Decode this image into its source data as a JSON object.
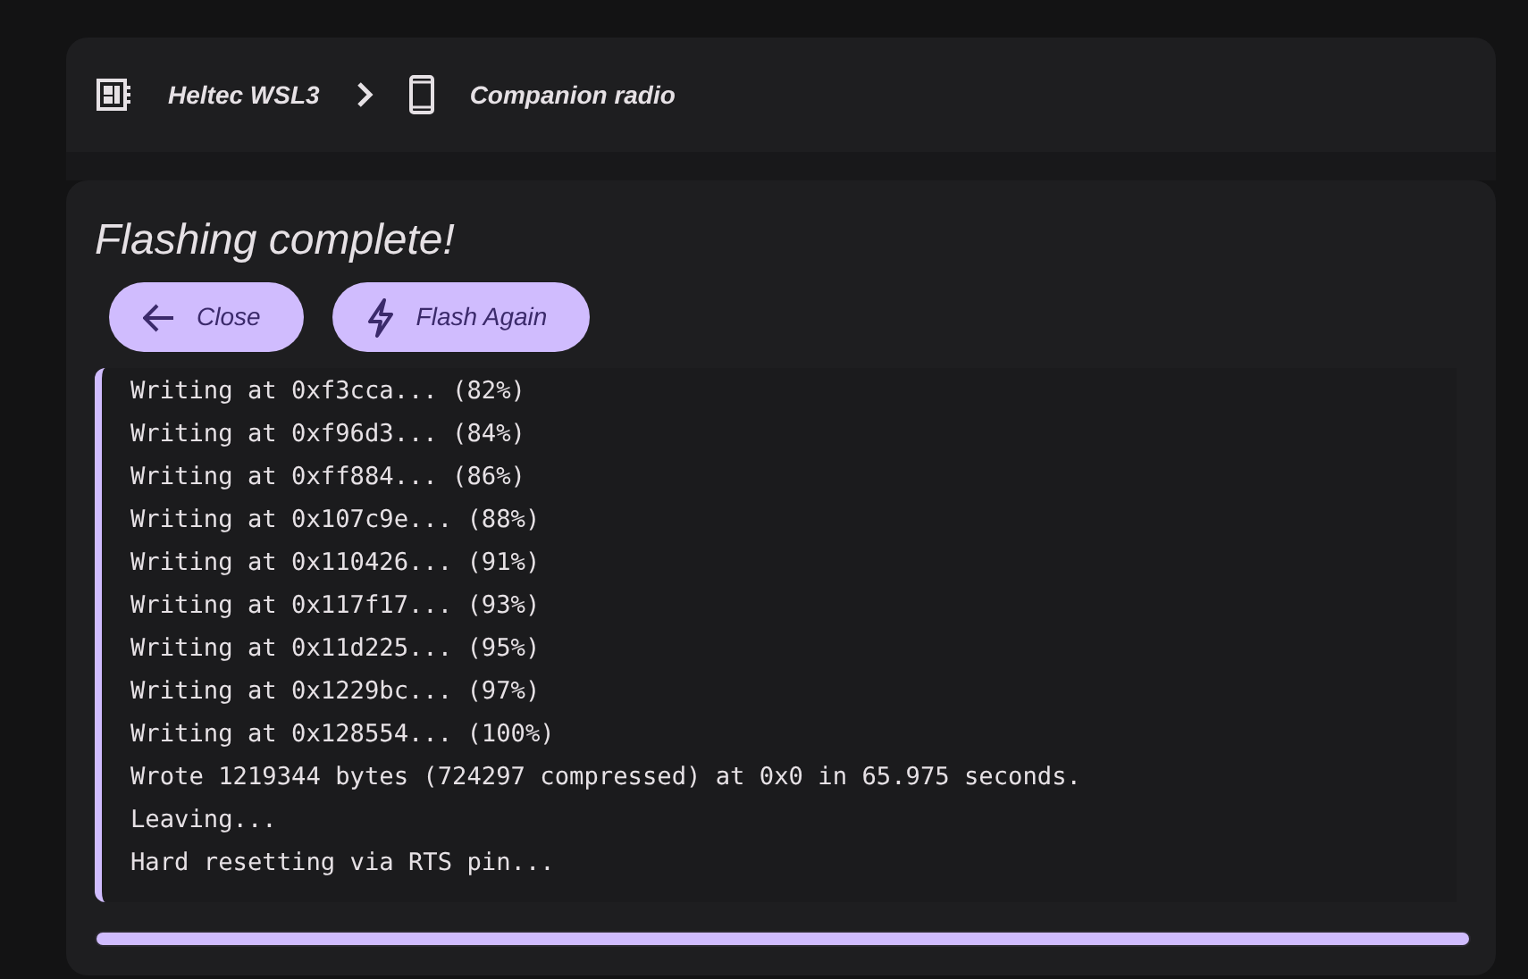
{
  "breadcrumb": [
    {
      "kind": "board",
      "label": "Heltec WSL3"
    },
    {
      "kind": "device",
      "label": "Companion radio"
    }
  ],
  "title": "Flashing complete!",
  "buttons": [
    {
      "kind": "back",
      "label": "Close"
    },
    {
      "kind": "flash",
      "label": "Flash Again"
    }
  ],
  "log": [
    "Writing at 0xf3cca... (82%)",
    "Writing at 0xf96d3... (84%)",
    "Writing at 0xff884... (86%)",
    "Writing at 0x107c9e... (88%)",
    "Writing at 0x110426... (91%)",
    "Writing at 0x117f17... (93%)",
    "Writing at 0x11d225... (95%)",
    "Writing at 0x1229bc... (97%)",
    "Writing at 0x128554... (100%)",
    "Wrote 1219344 bytes (724297 compressed) at 0x0 in 65.975 seconds.",
    "Leaving...",
    "Hard resetting via RTS pin..."
  ],
  "progress": {
    "level": 1
  }
}
